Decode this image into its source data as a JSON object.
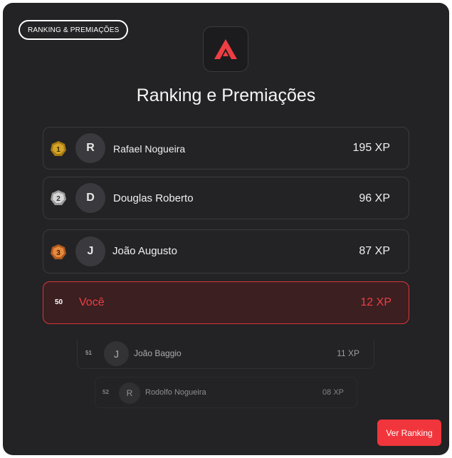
{
  "badge": {
    "label": "RANKING & PREMIAÇÕES"
  },
  "logo": {
    "icon": "red-triangle-a-logo",
    "color": "#ef3e43"
  },
  "title": "Ranking e Premiações",
  "top_ranks": [
    {
      "position": "1",
      "medal": "gold-medal-icon",
      "initial": "R",
      "name": "Rafael Nogueira",
      "xp": "195 XP"
    },
    {
      "position": "2",
      "medal": "silver-medal-icon",
      "initial": "D",
      "name": "Douglas Roberto",
      "xp": "96 XP"
    },
    {
      "position": "3",
      "medal": "bronze-medal-icon",
      "initial": "J",
      "name": "João Augusto",
      "xp": "87 XP"
    }
  ],
  "current_user": {
    "position": "50",
    "name": "Você",
    "xp": "12 XP"
  },
  "below_ranks": [
    {
      "position": "51",
      "initial": "J",
      "name": "João Baggio",
      "xp": "11 XP"
    },
    {
      "position": "52",
      "initial": "R",
      "name": "Rodolfo Nogueira",
      "xp": "08 XP"
    }
  ],
  "action_button": {
    "label": "Ver Ranking"
  },
  "colors": {
    "accent": "#f0363c",
    "card_bg": "#232325",
    "gold": "#c8961e",
    "silver": "#c7c7c7",
    "bronze": "#d9722e"
  }
}
